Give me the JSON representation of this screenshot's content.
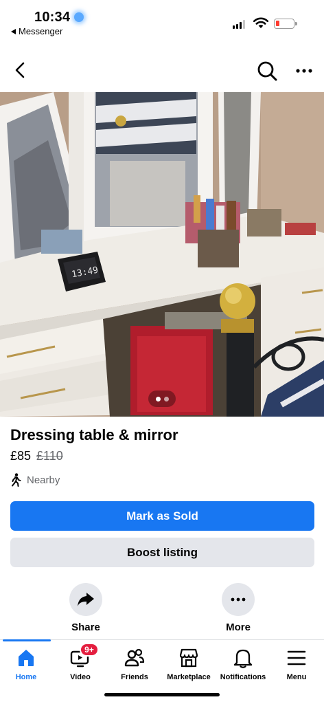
{
  "status_bar": {
    "time": "10:34",
    "back_app": "Messenger",
    "battery_color": "#ff3b30"
  },
  "nav": {
    "back_icon": "chevron-left-icon",
    "search_icon": "search-icon",
    "more_icon": "more-horizontal-icon"
  },
  "photo": {
    "description_icon": "listing-photo",
    "clock_display": "13:49",
    "page_count": 2,
    "current_page": 1
  },
  "listing": {
    "title": "Dressing table & mirror",
    "price": "£85",
    "original_price": "£110",
    "location": "Nearby"
  },
  "buttons": {
    "mark_sold": "Mark as Sold",
    "boost": "Boost listing"
  },
  "actions": {
    "share": "Share",
    "more": "More"
  },
  "tabs": [
    {
      "label": "Home",
      "icon": "home-icon",
      "active": true
    },
    {
      "label": "Video",
      "icon": "video-icon",
      "badge": "9+"
    },
    {
      "label": "Friends",
      "icon": "friends-icon"
    },
    {
      "label": "Marketplace",
      "icon": "marketplace-icon"
    },
    {
      "label": "Notifications",
      "icon": "bell-icon"
    },
    {
      "label": "Menu",
      "icon": "menu-icon"
    }
  ],
  "colors": {
    "accent": "#1877f2",
    "secondary_button": "#e4e6eb",
    "badge": "#e41e3f",
    "muted_text": "#65676b"
  }
}
